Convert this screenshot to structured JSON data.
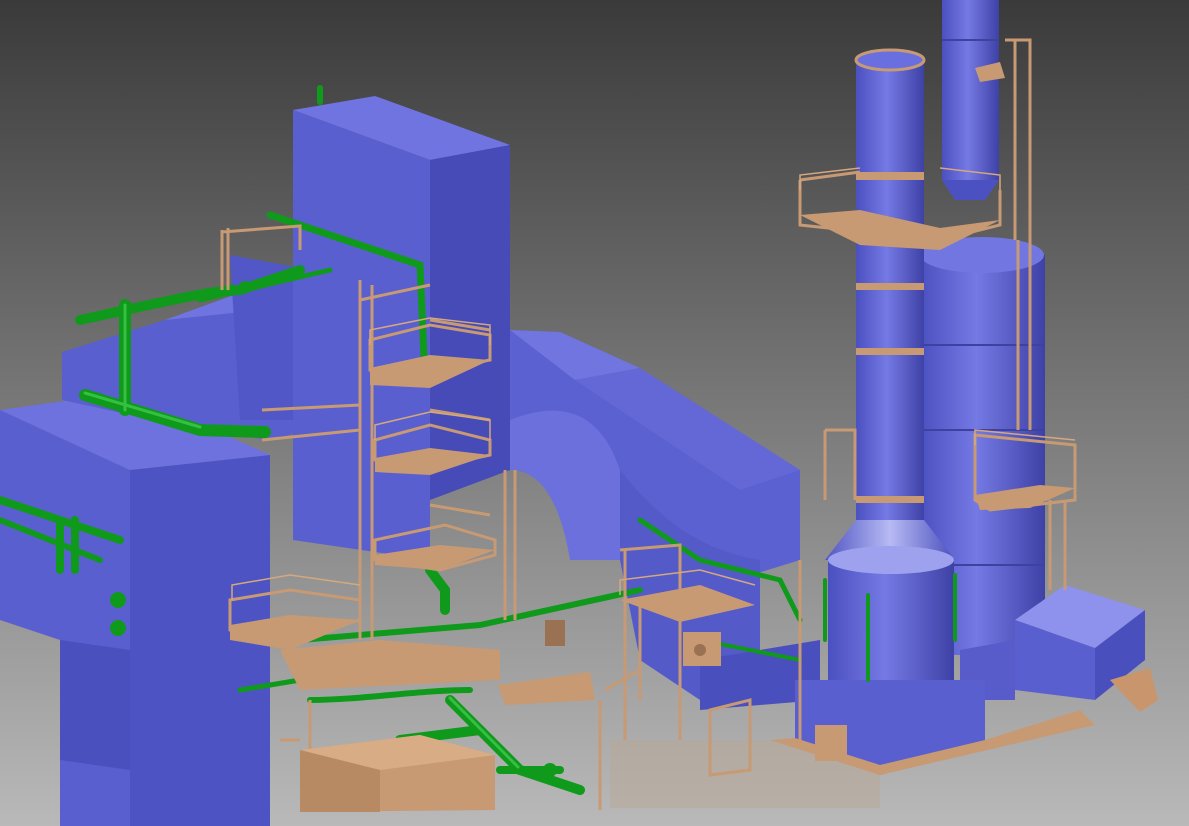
{
  "scene": {
    "subject": "industrial-plant-3d-cad-model",
    "colors": {
      "background_top": "#3a3a3a",
      "background_bottom": "#b9b9b9",
      "structure_blue": "#5a5fcf",
      "structure_blue_light": "#6f74e0",
      "structure_blue_dark": "#3f43a8",
      "steel_tan": "#c79a74",
      "steel_tan_dark": "#9a7152",
      "pipe_green": "#0f9a1c",
      "pipe_green_light": "#35c041"
    }
  }
}
